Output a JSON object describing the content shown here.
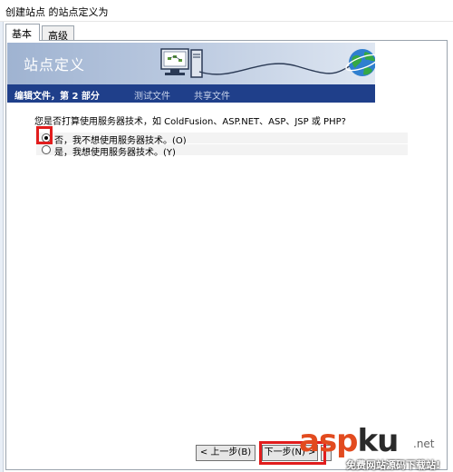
{
  "window": {
    "title": "创建站点 的站点定义为"
  },
  "tabs": [
    {
      "label": "基本",
      "active": true
    },
    {
      "label": "高级",
      "active": false
    }
  ],
  "banner": {
    "title": "站点定义"
  },
  "steps": [
    {
      "label": "编辑文件，第 2 部分",
      "active": true
    },
    {
      "label": "测试文件",
      "active": false
    },
    {
      "label": "共享文件",
      "active": false
    }
  ],
  "question": "您是否打算使用服务器技术，如 ColdFusion、ASP.NET、ASP、JSP 或 PHP?",
  "options": [
    {
      "label": "否，我不想使用服务器技术。(O)",
      "checked": true
    },
    {
      "label": "是，我想使用服务器技术。(Y)",
      "checked": false
    }
  ],
  "buttons": {
    "prev": "< 上一步(B)",
    "next": "下一步(N) >"
  },
  "watermark": {
    "main_a": "asp",
    "main_b": "ku",
    "dotnet": ".net",
    "sub": "免费网站源码下载站!"
  },
  "colors": {
    "step_bar": "#1f3f8a",
    "highlight": "#e11d1d",
    "watermark_brand": "#e24b1f"
  }
}
